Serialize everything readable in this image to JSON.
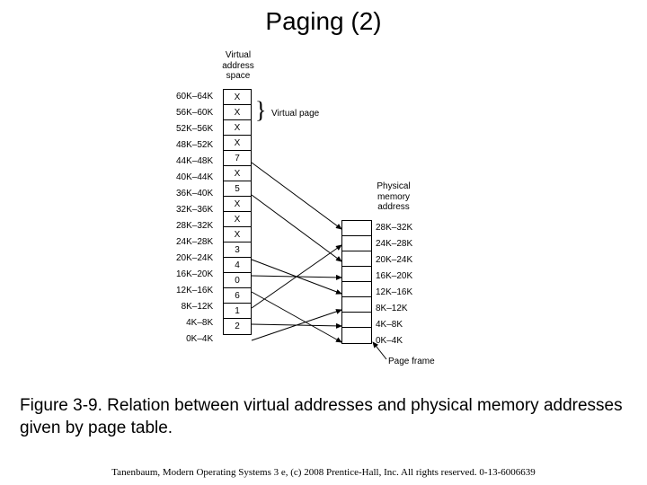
{
  "title": "Paging (2)",
  "virtual_header": "Virtual\naddress\nspace",
  "physical_header": "Physical\nmemory\naddress",
  "virtual_page_label": "Virtual page",
  "page_frame_label": "Page frame",
  "caption": "Figure 3-9. Relation between virtual addresses and physical memory addresses given by page table.",
  "footer": "Tanenbaum, Modern Operating Systems 3 e, (c) 2008 Prentice-Hall, Inc. All rights reserved. 0-13-6006639",
  "virtual": [
    {
      "range": "60K–64K",
      "val": "X"
    },
    {
      "range": "56K–60K",
      "val": "X"
    },
    {
      "range": "52K–56K",
      "val": "X"
    },
    {
      "range": "48K–52K",
      "val": "X"
    },
    {
      "range": "44K–48K",
      "val": "7"
    },
    {
      "range": "40K–44K",
      "val": "X"
    },
    {
      "range": "36K–40K",
      "val": "5"
    },
    {
      "range": "32K–36K",
      "val": "X"
    },
    {
      "range": "28K–32K",
      "val": "X"
    },
    {
      "range": "24K–28K",
      "val": "X"
    },
    {
      "range": "20K–24K",
      "val": "3"
    },
    {
      "range": "16K–20K",
      "val": "4"
    },
    {
      "range": "12K–16K",
      "val": "0"
    },
    {
      "range": "8K–12K",
      "val": "6"
    },
    {
      "range": "4K–8K",
      "val": "1"
    },
    {
      "range": "0K–4K",
      "val": "2"
    }
  ],
  "physical": [
    {
      "range": "28K–32K"
    },
    {
      "range": "24K–28K"
    },
    {
      "range": "20K–24K"
    },
    {
      "range": "16K–20K"
    },
    {
      "range": "12K–16K"
    },
    {
      "range": "8K–12K"
    },
    {
      "range": "4K–8K"
    },
    {
      "range": "0K–4K"
    }
  ],
  "mappings": [
    {
      "v_idx": 4,
      "p_idx": 0
    },
    {
      "v_idx": 6,
      "p_idx": 2
    },
    {
      "v_idx": 10,
      "p_idx": 4
    },
    {
      "v_idx": 11,
      "p_idx": 3
    },
    {
      "v_idx": 12,
      "p_idx": 7
    },
    {
      "v_idx": 13,
      "p_idx": 1
    },
    {
      "v_idx": 14,
      "p_idx": 6
    },
    {
      "v_idx": 15,
      "p_idx": 5
    }
  ]
}
